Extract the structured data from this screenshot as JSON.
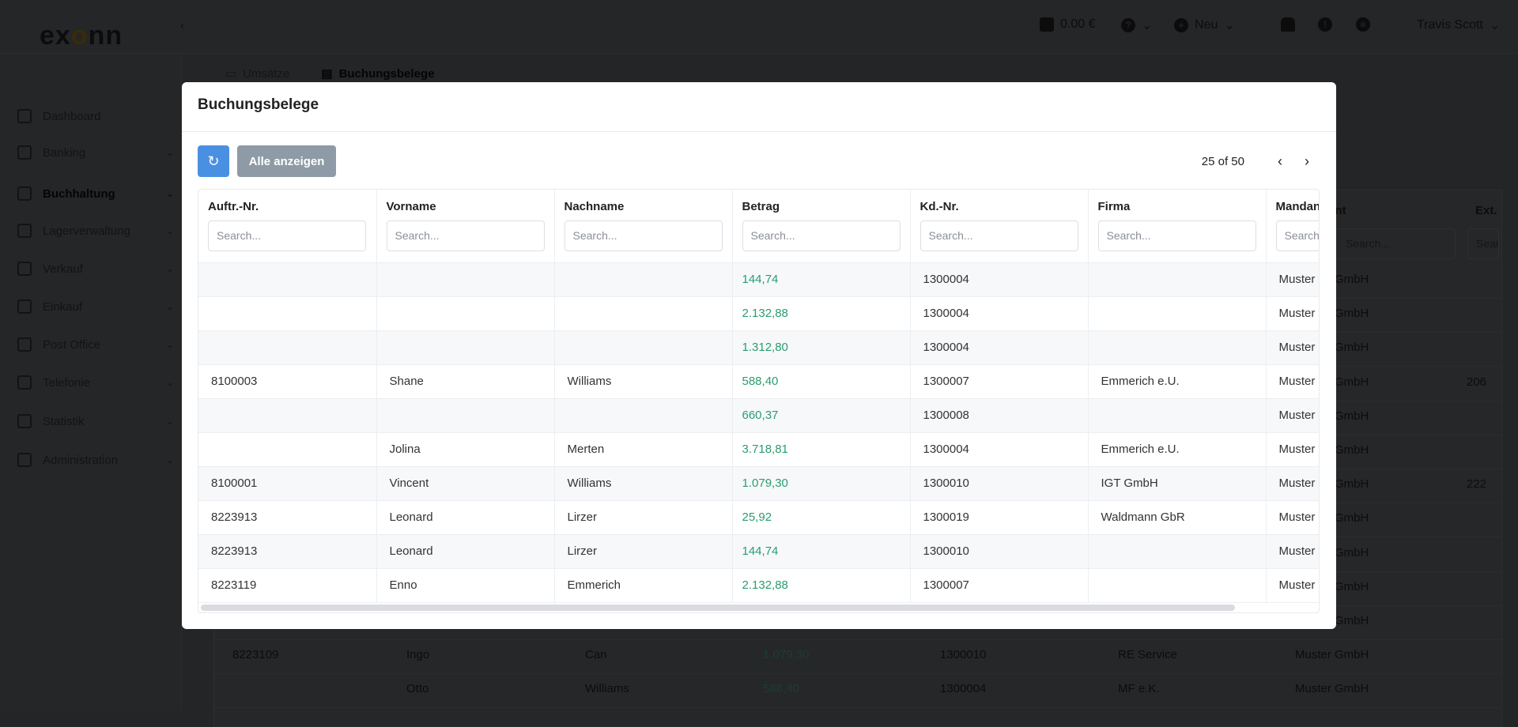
{
  "app": {
    "logo": "exonn",
    "balance": "0.00 €",
    "new_label": "Neu",
    "user_name": "Travis Scott"
  },
  "sidebar": {
    "items": [
      {
        "label": "Dashboard",
        "icon": "dashboard-icon",
        "chevron": false
      },
      {
        "label": "Banking",
        "icon": "bank-icon",
        "chevron": true
      },
      {
        "label": "Buchhaltung",
        "icon": "ledger-icon",
        "chevron": true,
        "active": true
      },
      {
        "label": "Lagerverwaltung",
        "icon": "box-icon",
        "chevron": true
      },
      {
        "label": "Verkauf",
        "icon": "store-icon",
        "chevron": true
      },
      {
        "label": "Einkauf",
        "icon": "cart-icon",
        "chevron": true
      },
      {
        "label": "Post Office",
        "icon": "mail-icon",
        "chevron": true
      },
      {
        "label": "Telefonie",
        "icon": "phone-icon",
        "chevron": true
      },
      {
        "label": "Statistik",
        "icon": "pie-chart-icon",
        "chevron": true
      },
      {
        "label": "Administration",
        "icon": "gear-icon",
        "chevron": true
      }
    ]
  },
  "page_tabs": [
    {
      "label": "Umsätze"
    },
    {
      "label": "Buchungsbelege",
      "active": true
    }
  ],
  "background_table": {
    "headers": [
      "Mandant",
      "Ext."
    ],
    "search_placeholder": "Search...",
    "rows": [
      {
        "mandant": "Muster GmbH",
        "ext": ""
      },
      {
        "mandant": "Muster GmbH",
        "ext": ""
      },
      {
        "mandant": "Muster GmbH",
        "ext": ""
      },
      {
        "mandant": "Muster GmbH",
        "ext": "206"
      },
      {
        "mandant": "Muster GmbH",
        "ext": ""
      },
      {
        "mandant": "Muster GmbH",
        "ext": ""
      },
      {
        "mandant": "Muster GmbH",
        "ext": "222"
      },
      {
        "mandant": "Muster GmbH",
        "ext": ""
      },
      {
        "mandant": "Muster GmbH",
        "ext": ""
      },
      {
        "mandant": "Muster GmbH",
        "ext": ""
      },
      {
        "mandant": "Muster GmbH",
        "ext": ""
      },
      {
        "auftr": "8223109",
        "vorname": "Ingo",
        "nachname": "Can",
        "betrag": "1.079,30",
        "kdnr": "1300010",
        "firma": "RE Service",
        "mandant": "Muster GmbH",
        "ext": ""
      },
      {
        "auftr": "",
        "vorname": "Otto",
        "nachname": "Williams",
        "betrag": "588,40",
        "kdnr": "1300004",
        "firma": "MF e.K.",
        "mandant": "Muster GmbH",
        "ext": ""
      }
    ]
  },
  "modal": {
    "title": "Buchungsbelege",
    "refresh_icon": "refresh-icon",
    "show_all_label": "Alle anzeigen",
    "pagination": "25 of 50",
    "columns": [
      "Auftr.-Nr.",
      "Vorname",
      "Nachname",
      "Betrag",
      "Kd.-Nr.",
      "Firma",
      "Mandant"
    ],
    "search_placeholder": "Search...",
    "amount_color": "#2a9d6e",
    "rows": [
      [
        "",
        "",
        "",
        "144,74",
        "1300004",
        "",
        "Muster GmbH"
      ],
      [
        "",
        "",
        "",
        "2.132,88",
        "1300004",
        "",
        "Muster GmbH"
      ],
      [
        "",
        "",
        "",
        "1.312,80",
        "1300004",
        "",
        "Muster GmbH"
      ],
      [
        "8100003",
        "Shane",
        "Williams",
        "588,40",
        "1300007",
        "Emmerich e.U.",
        "Muster GmbH"
      ],
      [
        "",
        "",
        "",
        "660,37",
        "1300008",
        "",
        "Muster GmbH"
      ],
      [
        "",
        "Jolina",
        "Merten",
        "3.718,81",
        "1300004",
        "Emmerich e.U.",
        "Muster GmbH"
      ],
      [
        "8100001",
        "Vincent",
        "Williams",
        "1.079,30",
        "1300010",
        "IGT GmbH",
        "Muster GmbH"
      ],
      [
        "8223913",
        "Leonard",
        "Lirzer",
        "25,92",
        "1300019",
        "Waldmann GbR",
        "Muster GmbH"
      ],
      [
        "8223913",
        "Leonard",
        "Lirzer",
        "144,74",
        "1300010",
        "",
        "Muster GmbH"
      ],
      [
        "8223119",
        "Enno",
        "Emmerich",
        "2.132,88",
        "1300007",
        "",
        "Muster GmbH"
      ]
    ]
  }
}
